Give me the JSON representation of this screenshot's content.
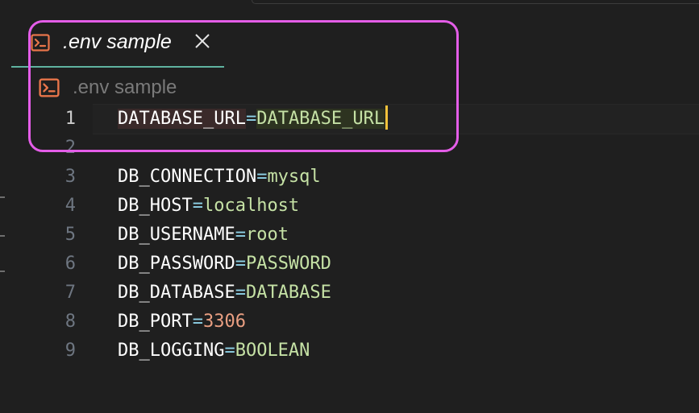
{
  "tab": {
    "title": ".env sample",
    "icon": "terminal-icon",
    "close_icon": "close-icon",
    "icon_color": "#e8754a",
    "underline_color": "#5fb3a0"
  },
  "breadcrumb": {
    "label": ".env sample",
    "icon": "terminal-icon"
  },
  "editor": {
    "lines": [
      {
        "number": "1",
        "key": "DATABASE_URL",
        "eq": "=",
        "value": "DATABASE_URL",
        "value_kind": "string",
        "active": true
      },
      {
        "number": "2",
        "key": "",
        "eq": "",
        "value": "",
        "value_kind": "string",
        "active": false
      },
      {
        "number": "3",
        "key": "DB_CONNECTION",
        "eq": "=",
        "value": "mysql",
        "value_kind": "string",
        "active": false
      },
      {
        "number": "4",
        "key": "DB_HOST",
        "eq": "=",
        "value": "localhost",
        "value_kind": "string",
        "active": false
      },
      {
        "number": "5",
        "key": "DB_USERNAME",
        "eq": "=",
        "value": "root",
        "value_kind": "string",
        "active": false
      },
      {
        "number": "6",
        "key": "DB_PASSWORD",
        "eq": "=",
        "value": "PASSWORD",
        "value_kind": "string",
        "active": false
      },
      {
        "number": "7",
        "key": "DB_DATABASE",
        "eq": "=",
        "value": "DATABASE",
        "value_kind": "string",
        "active": false
      },
      {
        "number": "8",
        "key": "DB_PORT",
        "eq": "=",
        "value": "3306",
        "value_kind": "number",
        "active": false
      },
      {
        "number": "9",
        "key": "DB_LOGGING",
        "eq": "=",
        "value": "BOOLEAN",
        "value_kind": "string",
        "active": false
      }
    ]
  },
  "colors": {
    "background": "#1f1f1f",
    "key": "#ffffff",
    "equals": "#8fd3e8",
    "string_value": "#c5e1a5",
    "number_value": "#ea9f82",
    "cursor": "#f0c23a",
    "annotation_box": "#e45de8"
  }
}
